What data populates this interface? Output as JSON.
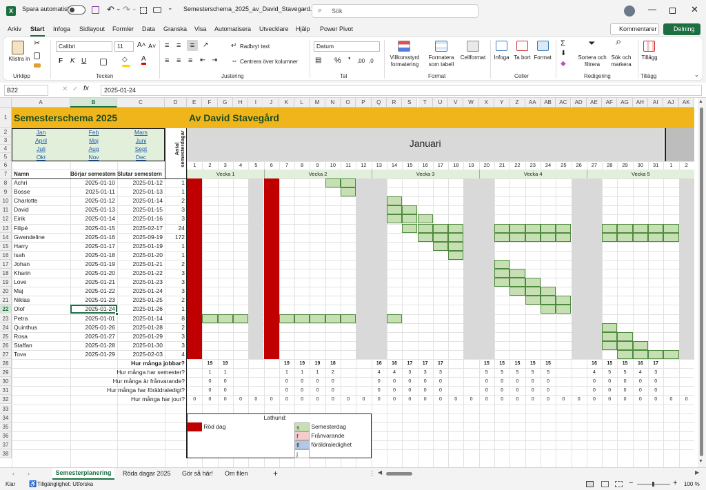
{
  "titlebar": {
    "autosave": "Spara automatiskt",
    "filename": "Semesterschema_2025_av_David_Stavegard....",
    "search_placeholder": "Sök"
  },
  "tabs": [
    "Arkiv",
    "Start",
    "Infoga",
    "Sidlayout",
    "Formler",
    "Data",
    "Granska",
    "Visa",
    "Automatisera",
    "Utvecklare",
    "Hjälp",
    "Power Pivot"
  ],
  "comments_label": "Kommentarer",
  "share_label": "Delning",
  "ribbon": {
    "paste": "Klistra in",
    "clipboard": "Urklipp",
    "font_name": "Calibri",
    "font_size": "11",
    "font_group": "Tecken",
    "wrap": "Radbryt text",
    "merge": "Centrera över kolumner",
    "align_group": "Justering",
    "number_format": "Datum",
    "number_group": "Tal",
    "cond_format": "Villkorsstyrd formatering",
    "format_table": "Formatera som tabell",
    "cell_styles": "Cellformat",
    "style_group": "Format",
    "insert": "Infoga",
    "delete": "Ta bort",
    "format": "Format",
    "cells_group": "Celler",
    "sort": "Sortera och filtrera",
    "find": "Sök och markera",
    "edit_group": "Redigering",
    "addins": "Tillägg",
    "addins_group": "Tillägg"
  },
  "formula": {
    "namebox": "B22",
    "value": "2025-01-24"
  },
  "col_headers": [
    "A",
    "B",
    "C",
    "D",
    "E",
    "F",
    "G",
    "H",
    "I",
    "J",
    "K",
    "L",
    "M",
    "N",
    "O",
    "P",
    "Q",
    "R",
    "S",
    "T",
    "U",
    "V",
    "W",
    "X",
    "Y",
    "Z",
    "AA",
    "AB",
    "AC",
    "AD",
    "AE",
    "AF",
    "AG",
    "AH",
    "AI",
    "AJ",
    "AK"
  ],
  "sheet": {
    "title": "Semesterschema 2025",
    "author": "Av David Stavegård",
    "month": "Januari",
    "months": [
      "Jan",
      "Feb",
      "Mars",
      "April",
      "Maj",
      "Juni",
      "Juli",
      "Aug",
      "Sept",
      "Okt",
      "Nov",
      "Dec"
    ],
    "h_name": "Namn",
    "h_start": "Börjar semestern",
    "h_end": "Slutar semestern",
    "h_days": "Antal semesterdagar",
    "days": [
      "1",
      "2",
      "3",
      "4",
      "5",
      "6",
      "7",
      "8",
      "9",
      "10",
      "11",
      "12",
      "13",
      "14",
      "15",
      "16",
      "17",
      "18",
      "19",
      "20",
      "21",
      "22",
      "23",
      "24",
      "25",
      "26",
      "27",
      "28",
      "29",
      "30",
      "31",
      "1",
      "2"
    ],
    "weeks": [
      "Vecka 1",
      "Vecka 2",
      "Vecka 3",
      "Vecka 4",
      "Vecka 5"
    ],
    "people": [
      [
        "Achri",
        "2025-01-10",
        "2025-01-12",
        "1"
      ],
      [
        "Bosse",
        "2025-01-11",
        "2025-01-13",
        "1"
      ],
      [
        "Charlotte",
        "2025-01-12",
        "2025-01-14",
        "2"
      ],
      [
        "David",
        "2025-01-13",
        "2025-01-15",
        "3"
      ],
      [
        "Eirik",
        "2025-01-14",
        "2025-01-16",
        "3"
      ],
      [
        "Filipé",
        "2025-01-15",
        "2025-02-17",
        "24"
      ],
      [
        "Gwendeline",
        "2025-01-16",
        "2025-09-19",
        "172"
      ],
      [
        "Harry",
        "2025-01-17",
        "2025-01-19",
        "1"
      ],
      [
        "Isah",
        "2025-01-18",
        "2025-01-20",
        "1"
      ],
      [
        "Johan",
        "2025-01-19",
        "2025-01-21",
        "2"
      ],
      [
        "Kharin",
        "2025-01-20",
        "2025-01-22",
        "3"
      ],
      [
        "Love",
        "2025-01-21",
        "2025-01-23",
        "3"
      ],
      [
        "Maj",
        "2025-01-22",
        "2025-01-24",
        "3"
      ],
      [
        "Niklas",
        "2025-01-23",
        "2025-01-25",
        "2"
      ],
      [
        "Olof",
        "2025-01-24",
        "2025-01-26",
        "1"
      ],
      [
        "Petra",
        "2025-01-01",
        "2025-01-14",
        "8"
      ],
      [
        "Quinthus",
        "2025-01-26",
        "2025-01-28",
        "2"
      ],
      [
        "Rosa",
        "2025-01-27",
        "2025-01-29",
        "3"
      ],
      [
        "Staffan",
        "2025-01-28",
        "2025-01-30",
        "3"
      ],
      [
        "Tova",
        "2025-01-29",
        "2025-02-03",
        "4"
      ]
    ],
    "q_work": "Hur många jobbar?",
    "q_vac": "Hur många har semester?",
    "q_absent": "Hur många är frånvarande?",
    "q_parental": "Hur många har föräldraledigt?",
    "q_oncall": "Hur många har jour?",
    "work": [
      "",
      "19",
      "19",
      "",
      "",
      "",
      "19",
      "19",
      "19",
      "18",
      "",
      "",
      "16",
      "16",
      "17",
      "17",
      "17",
      "",
      "",
      "15",
      "15",
      "15",
      "15",
      "15",
      "",
      "",
      "16",
      "15",
      "15",
      "16",
      "17",
      "",
      ""
    ],
    "vac": [
      "",
      "1",
      "1",
      "",
      "",
      "",
      "1",
      "1",
      "1",
      "2",
      "",
      "",
      "4",
      "4",
      "3",
      "3",
      "3",
      "",
      "",
      "5",
      "5",
      "5",
      "5",
      "5",
      "",
      "",
      "4",
      "5",
      "5",
      "4",
      "3",
      "",
      ""
    ],
    "absent": [
      "",
      "0",
      "0",
      "",
      "",
      "",
      "0",
      "0",
      "0",
      "0",
      "",
      "",
      "0",
      "0",
      "0",
      "0",
      "0",
      "",
      "",
      "0",
      "0",
      "0",
      "0",
      "0",
      "",
      "",
      "0",
      "0",
      "0",
      "0",
      "0",
      "",
      ""
    ],
    "parental": [
      "",
      "0",
      "0",
      "",
      "",
      "",
      "0",
      "0",
      "0",
      "0",
      "",
      "",
      "0",
      "0",
      "0",
      "0",
      "0",
      "",
      "",
      "0",
      "0",
      "0",
      "0",
      "0",
      "",
      "",
      "0",
      "0",
      "0",
      "0",
      "0",
      "",
      ""
    ],
    "oncall": [
      "0",
      "0",
      "0",
      "0",
      "0",
      "0",
      "0",
      "0",
      "0",
      "0",
      "0",
      "0",
      "0",
      "0",
      "0",
      "0",
      "0",
      "0",
      "0",
      "0",
      "0",
      "0",
      "0",
      "0",
      "0",
      "0",
      "0",
      "0",
      "0",
      "0",
      "0",
      "0",
      "0"
    ],
    "legend": {
      "title": "Lathund:",
      "red": "Röd dag",
      "vac_code": "s",
      "vac": "Semesterdag",
      "absent_code": "f",
      "absent": "Frånvarande",
      "parental_code": "fl",
      "parental": "föräldraledighet",
      "oncall_code": "j"
    },
    "colors": {
      "header": "#f0b51b",
      "month_band": "#d9d9d9",
      "vacation": "#c6e0b4",
      "red": "#c00000",
      "weekend": "#d9d9d9",
      "week_bg": "#e2efda"
    }
  },
  "sheet_tabs": [
    "Semesterplanering",
    "Röda dagar 2025",
    "Gör så här!",
    "Om filen"
  ],
  "status": {
    "ready": "Klar",
    "accessibility": "Tillgänglighet: Utforska",
    "zoom": "100 %"
  }
}
